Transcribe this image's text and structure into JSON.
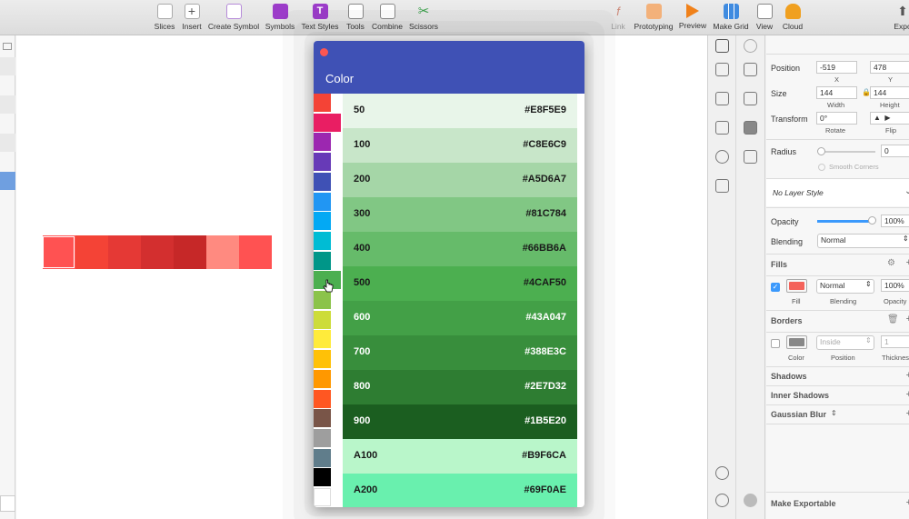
{
  "toolbar": {
    "left_tools": [
      {
        "label": "Slices",
        "icon": "slice-icon"
      },
      {
        "label": "Insert",
        "icon": "plus-icon"
      },
      {
        "label": "Create Symbol",
        "icon": "create-symbol-icon"
      },
      {
        "label": "Symbols",
        "icon": "symbols-icon"
      },
      {
        "label": "Text Styles",
        "icon": "text-styles-icon"
      },
      {
        "label": "Tools",
        "icon": "tools-icon"
      },
      {
        "label": "Combine",
        "icon": "combine-icon"
      },
      {
        "label": "Scissors",
        "icon": "scissors-icon"
      }
    ],
    "right_tools": [
      {
        "label": "Link",
        "icon": "link-icon"
      },
      {
        "label": "Prototyping",
        "icon": "prototyping-icon"
      },
      {
        "label": "Preview",
        "icon": "preview-icon"
      },
      {
        "label": "Make Grid",
        "icon": "make-grid-icon"
      },
      {
        "label": "View",
        "icon": "view-icon"
      },
      {
        "label": "Cloud",
        "icon": "cloud-icon"
      },
      {
        "label": "Expo",
        "icon": "export-icon"
      }
    ]
  },
  "canvas": {
    "swatch_colors": [
      "#ff5252",
      "#f44336",
      "#e53935",
      "#d32f2f",
      "#c62828",
      "#ff8a80",
      "#ff5252"
    ]
  },
  "color_popup": {
    "title": "Color",
    "header_color": "#3f51b5",
    "hue_colors": [
      "#f44336",
      "#e91e63",
      "#9c27b0",
      "#673ab7",
      "#3f51b5",
      "#2196f3",
      "#03a9f4",
      "#00bcd4",
      "#009688",
      "#4caf50",
      "#8bc34a",
      "#cddc39",
      "#ffeb3b",
      "#ffc107",
      "#ff9800",
      "#ff5722",
      "#795548",
      "#9e9e9e",
      "#607d8b",
      "#000000",
      "#ffffff"
    ],
    "selected_hue_index": 9,
    "shades": [
      {
        "name": "50",
        "hex": "#E8F5E9",
        "dark_text": true
      },
      {
        "name": "100",
        "hex": "#C8E6C9",
        "dark_text": true
      },
      {
        "name": "200",
        "hex": "#A5D6A7",
        "dark_text": true
      },
      {
        "name": "300",
        "hex": "#81C784",
        "dark_text": true
      },
      {
        "name": "400",
        "hex": "#66BB6A",
        "dark_text": true
      },
      {
        "name": "500",
        "hex": "#4CAF50",
        "dark_text": true
      },
      {
        "name": "600",
        "hex": "#43A047",
        "dark_text": false
      },
      {
        "name": "700",
        "hex": "#388E3C",
        "dark_text": false
      },
      {
        "name": "800",
        "hex": "#2E7D32",
        "dark_text": false
      },
      {
        "name": "900",
        "hex": "#1B5E20",
        "dark_text": false
      },
      {
        "name": "A100",
        "hex": "#B9F6CA",
        "dark_text": true
      },
      {
        "name": "A200",
        "hex": "#69F0AE",
        "dark_text": true
      }
    ]
  },
  "inspector": {
    "position_label": "Position",
    "x_value": "-519",
    "x_label": "X",
    "y_value": "478",
    "y_label": "Y",
    "size_label": "Size",
    "width_value": "144",
    "width_label": "Width",
    "height_value": "144",
    "height_label": "Height",
    "transform_label": "Transform",
    "rotate_value": "0°",
    "rotate_label": "Rotate",
    "flip_label": "Flip",
    "radius_label": "Radius",
    "radius_value": "0",
    "smooth_corners_label": "Smooth Corners",
    "layer_style": "No Layer Style",
    "opacity_label": "Opacity",
    "opacity_value": "100%",
    "opacity_fraction": 1.0,
    "blending_label": "Blending",
    "blending_value": "Normal",
    "fills_label": "Fills",
    "fill_color": "#f4625a",
    "fill_blending": "Normal",
    "fill_opacity": "100%",
    "fill_sub_label": "Fill",
    "fill_blending_sub": "Blending",
    "fill_opacity_sub": "Opacity",
    "borders_label": "Borders",
    "border_color": "#888888",
    "border_position": "Inside",
    "border_thickness": "1",
    "border_color_sub": "Color",
    "border_position_sub": "Position",
    "border_thickness_sub": "Thickness",
    "shadows_label": "Shadows",
    "inner_shadows_label": "Inner Shadows",
    "gaussian_blur_label": "Gaussian Blur",
    "make_exportable_label": "Make Exportable"
  }
}
